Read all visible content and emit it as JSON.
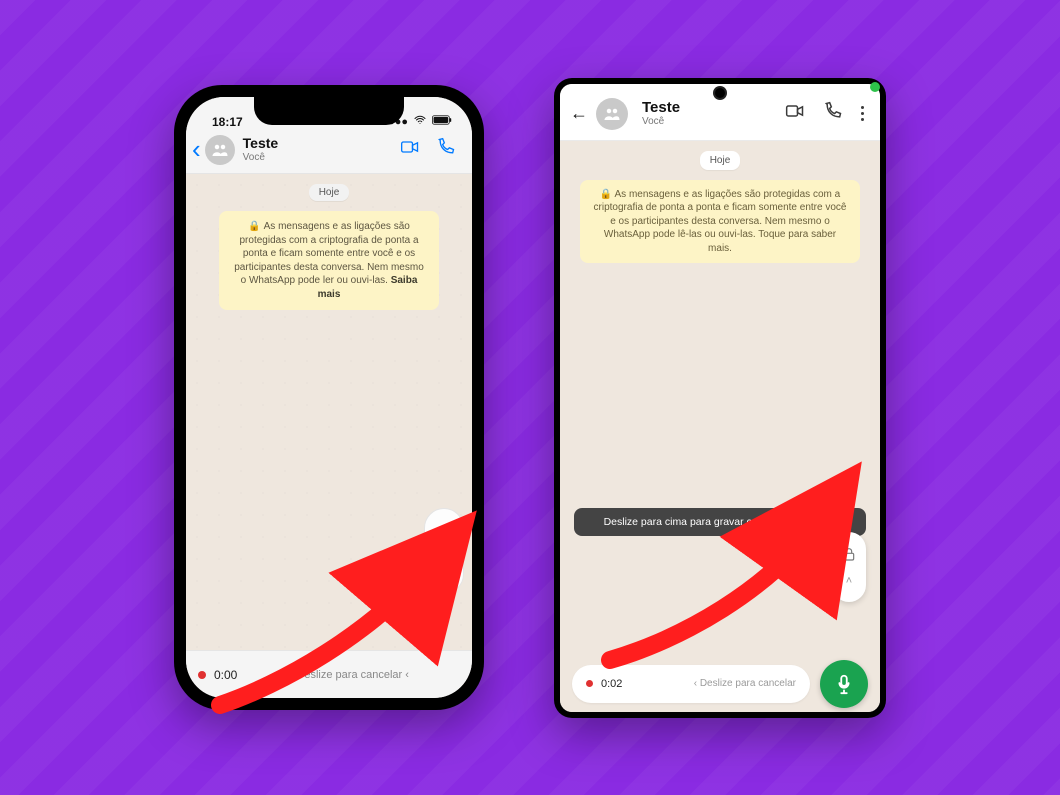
{
  "colors": {
    "background": "#8A2BE2",
    "arrow": "#ff1e1e",
    "mic_button": "#1aa350"
  },
  "ios": {
    "status_time": "18:17",
    "header": {
      "chat_title": "Teste",
      "chat_subtitle": "Você"
    },
    "date_label": "Hoje",
    "encryption_notice": "As mensagens e as ligações são protegidas com a criptografia de ponta a ponta e ficam somente entre você e os participantes desta conversa. Nem mesmo o WhatsApp pode ler ou ouvi-las.",
    "encryption_more": "Saiba mais",
    "recording": {
      "timer": "0:00",
      "cancel_hint": "Deslize para cancelar"
    }
  },
  "android": {
    "header": {
      "chat_title": "Teste",
      "chat_subtitle": "Você"
    },
    "date_label": "Hoje",
    "encryption_notice": "As mensagens e as ligações são protegidas com a criptografia de ponta a ponta e ficam somente entre você e os participantes desta conversa. Nem mesmo o WhatsApp pode lê-las ou ouvi-las. Toque para saber mais.",
    "tooltip": "Deslize para cima para gravar com as mãos livres",
    "recording": {
      "timer": "0:02",
      "cancel_hint": "Deslize para cancelar"
    }
  }
}
